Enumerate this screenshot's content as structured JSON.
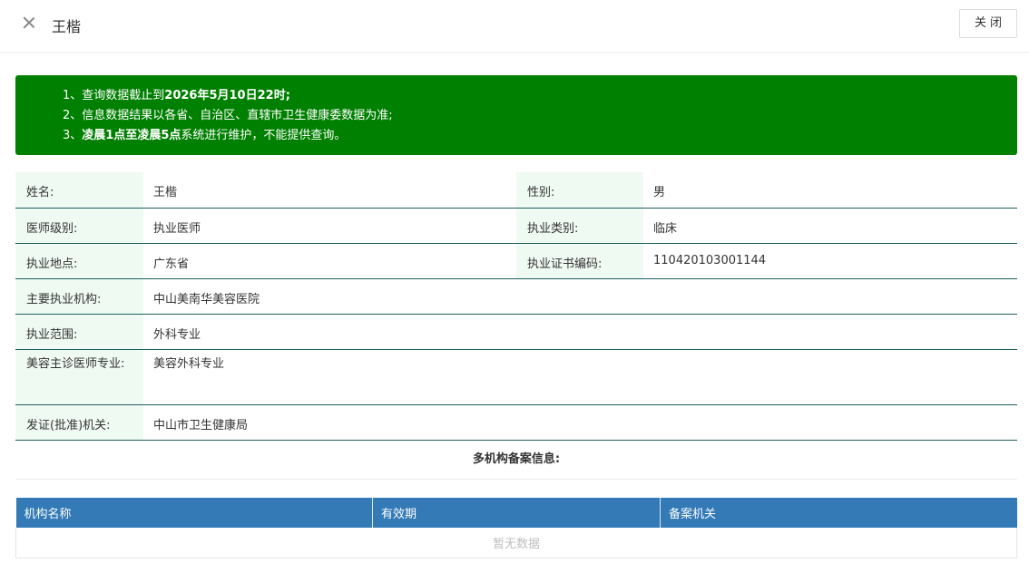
{
  "header": {
    "title": "王楷",
    "close_label": "关闭"
  },
  "notice": {
    "line1_prefix": "1、查询数据截止到",
    "line1_bold": "2026年5月10日22时;",
    "line2": "2、信息数据结果以各省、自治区、直辖市卫生健康委数据为准;",
    "line3_prefix": "3、",
    "line3_bold": "凌晨1点至凌晨5点",
    "line3_suffix": "系统进行维护，不能提供查询。",
    "background_color": "#008000"
  },
  "info": {
    "name_label": "姓名:",
    "name_value": "王楷",
    "gender_label": "性别:",
    "gender_value": "男",
    "level_label": "医师级别:",
    "level_value": "执业医师",
    "category_label": "执业类别:",
    "category_value": "临床",
    "location_label": "执业地点:",
    "location_value": "广东省",
    "cert_label": "执业证书编码:",
    "cert_value": "110420103001144",
    "institution_label": "主要执业机构:",
    "institution_value": "中山美南华美容医院",
    "scope_label": "执业范围:",
    "scope_value": "外科专业",
    "cosmetic_label": "美容主诊医师专业:",
    "cosmetic_value": "美容外科专业",
    "issuer_label": "发证(批准)机关:",
    "issuer_value": "中山市卫生健康局",
    "label_bg": "#effaf3"
  },
  "records": {
    "section_title": "多机构备案信息:",
    "columns": [
      "机构名称",
      "有效期",
      "备案机关"
    ],
    "empty_text": "暂无数据",
    "header_color": "#337ab7"
  }
}
